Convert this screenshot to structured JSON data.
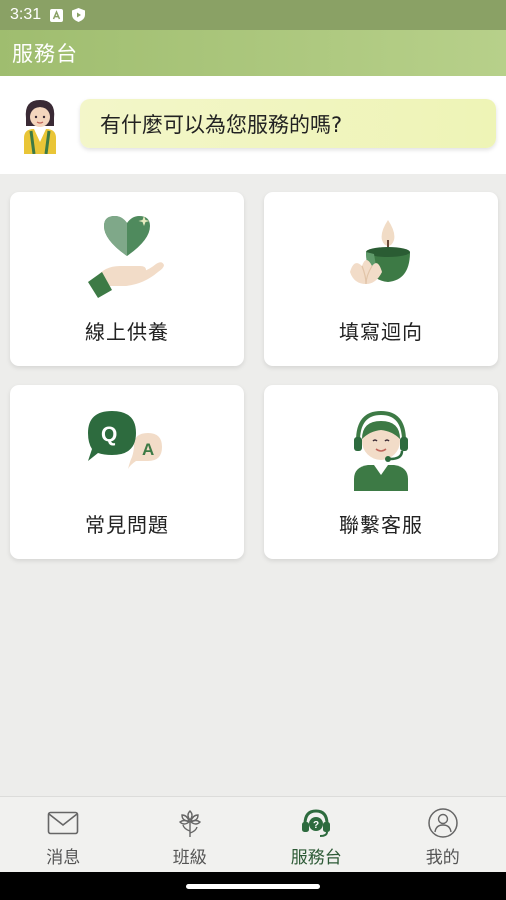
{
  "status_bar": {
    "time": "3:31",
    "icons": [
      "a-icon",
      "shield-play-icon"
    ]
  },
  "app_bar": {
    "title": "服務台"
  },
  "greeting": {
    "avatar": "assistant-avatar",
    "message": "有什麼可以為您服務的嗎?"
  },
  "cards": [
    {
      "label": "線上供養",
      "icon": "heart-hand-icon"
    },
    {
      "label": "填寫迴向",
      "icon": "lotus-candle-icon"
    },
    {
      "label": "常見問題",
      "icon": "qa-bubble-icon"
    },
    {
      "label": "聯繫客服",
      "icon": "customer-service-icon"
    }
  ],
  "bottom_nav": {
    "items": [
      {
        "label": "消息",
        "icon": "mail-icon",
        "active": false
      },
      {
        "label": "班級",
        "icon": "flower-icon",
        "active": false
      },
      {
        "label": "服務台",
        "icon": "headset-icon",
        "active": true
      },
      {
        "label": "我的",
        "icon": "profile-icon",
        "active": false
      }
    ]
  },
  "colors": {
    "brand": "#9fbd6f",
    "accent_green": "#2d6b3e",
    "bubble": "#f0f5bf"
  }
}
